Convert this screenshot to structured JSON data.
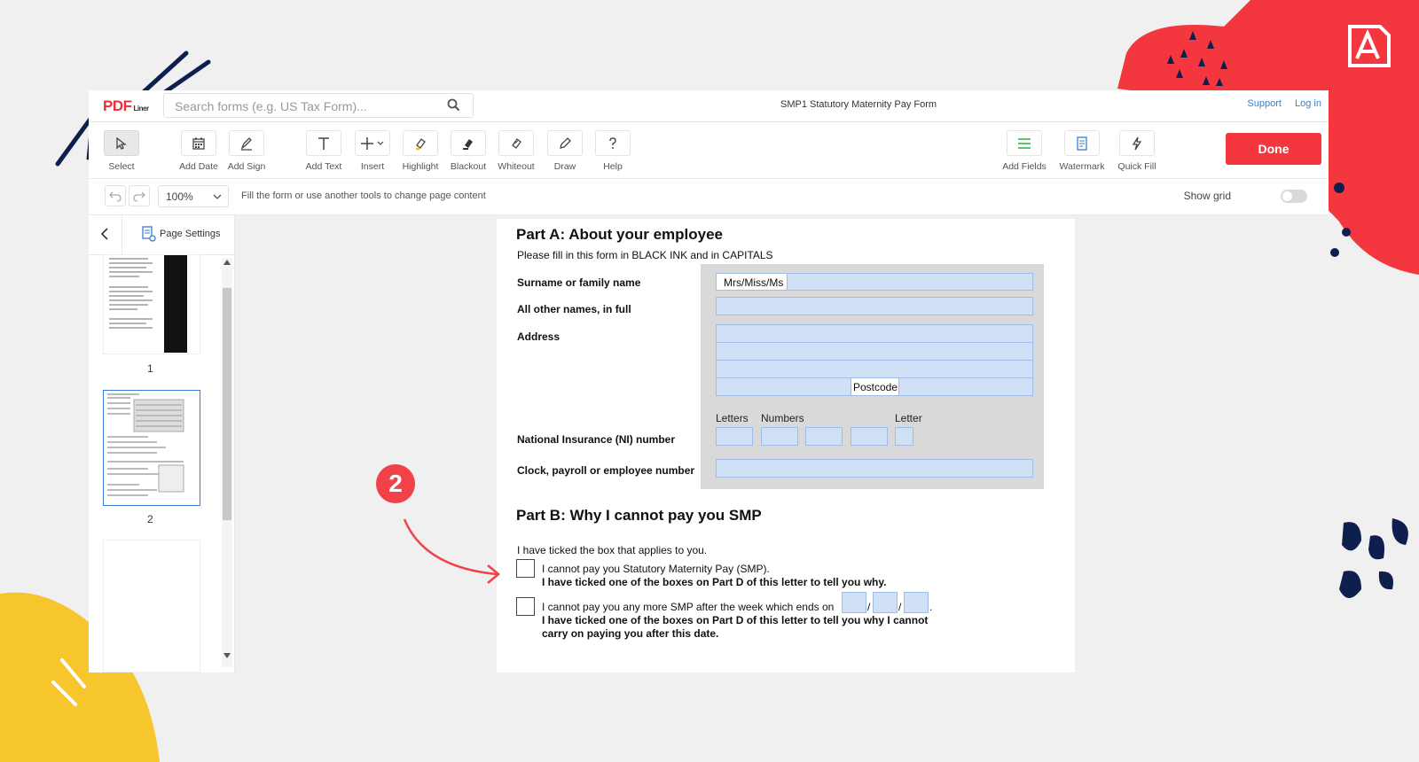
{
  "topbar": {
    "logo_main": "PDF",
    "logo_sub": "Liner",
    "search_placeholder": "Search forms (e.g. US Tax Form)...",
    "document_title": "SMP1 Statutory Maternity Pay Form",
    "support_label": "Support",
    "login_label": "Log in"
  },
  "toolbar": {
    "tools": [
      {
        "label": "Select",
        "icon": "cursor-icon"
      },
      {
        "label": "Add Date",
        "icon": "calendar-icon"
      },
      {
        "label": "Add Sign",
        "icon": "signature-icon"
      },
      {
        "label": "Add Text",
        "icon": "text-icon"
      },
      {
        "label": "Insert",
        "icon": "plus-icon"
      },
      {
        "label": "Highlight",
        "icon": "highlighter-icon"
      },
      {
        "label": "Blackout",
        "icon": "blackout-icon"
      },
      {
        "label": "Whiteout",
        "icon": "whiteout-icon"
      },
      {
        "label": "Draw",
        "icon": "pen-icon"
      },
      {
        "label": "Help",
        "icon": "help-icon"
      }
    ],
    "right_tools": [
      {
        "label": "Add Fields",
        "icon": "fields-icon"
      },
      {
        "label": "Watermark",
        "icon": "watermark-icon"
      },
      {
        "label": "Quick Fill",
        "icon": "lightning-icon"
      }
    ],
    "done_label": "Done"
  },
  "subbar": {
    "zoom": "100%",
    "hint": "Fill the form or use another tools to change page content",
    "show_grid_label": "Show grid"
  },
  "left_panel": {
    "page_settings_label": "Page Settings",
    "pages": [
      "1",
      "2"
    ]
  },
  "form": {
    "part_a_title": "Part A: About your employee",
    "part_a_instruction": "Please fill in this form in BLACK INK and in CAPITALS",
    "surname_label": "Surname or family name",
    "title_value": "Mrs/Miss/Ms",
    "other_names_label": "All other names, in full",
    "address_label": "Address",
    "postcode_label": "Postcode",
    "ni_label": "National Insurance (NI) number",
    "letters_label": "Letters",
    "numbers_label": "Numbers",
    "letter_label": "Letter",
    "clock_label": "Clock, payroll or employee number",
    "part_b_title": "Part B: Why I cannot pay you SMP",
    "part_b_instruction": "I have ticked the box that applies to you.",
    "option1_line1": "I cannot pay you Statutory Maternity Pay (SMP).",
    "option1_line2": "I have ticked one of the boxes on Part D of this letter to tell you why.",
    "option2_line1": "I cannot pay you any more SMP after the week which ends on",
    "option2_line2": "I have ticked one of the boxes on Part D of this letter to tell you why I cannot",
    "option2_line3": "carry on paying you after this date.",
    "date_sep": "/",
    "date_end": "."
  },
  "annotation": {
    "step_number": "2"
  },
  "colors": {
    "accent_red": "#f4373f",
    "link_blue": "#3a7bd5",
    "field_blue": "#cfe0f7",
    "deco_yellow": "#f7c52c",
    "deco_navy": "#0e1f4d"
  }
}
